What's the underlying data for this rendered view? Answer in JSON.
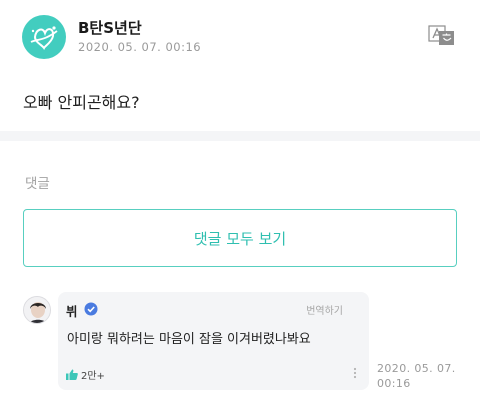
{
  "post": {
    "author": "B탄S년단",
    "time": "2020. 05. 07. 00:16",
    "body": "오빠 안피곤해요?"
  },
  "comments_section": {
    "title": "댓글",
    "view_all_label": "댓글 모두 보기"
  },
  "comment": {
    "author": "뷔",
    "translate_label": "번역하기",
    "text": "아미랑 뭐하려는 마음이 잠을 이겨버렸나봐요",
    "likes": "2만+",
    "time": "2020. 05. 07. 00:16"
  },
  "colors": {
    "accent": "#42cdbf",
    "verified": "#4a7be0"
  },
  "icons": [
    "translate-icon",
    "verified-icon",
    "like-icon",
    "more-icon"
  ]
}
